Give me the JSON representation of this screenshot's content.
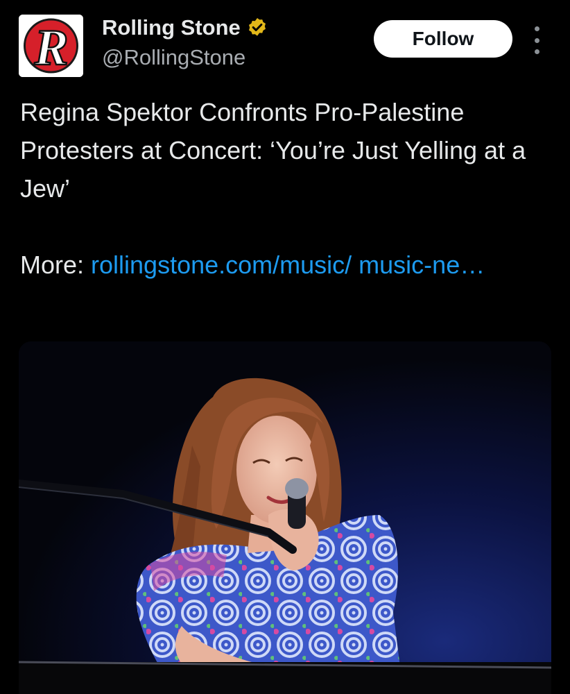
{
  "author": {
    "name": "Rolling Stone",
    "handle": "@RollingStone",
    "avatar_letter": "R",
    "verified_icon": "gold-verified-badge",
    "avatar_color": "#d6202a"
  },
  "actions": {
    "follow_label": "Follow",
    "more_icon": "vertical-ellipsis"
  },
  "tweet": {
    "headline": "Regina Spektor Confronts Pro-Palestine Protesters at Concert: ‘You’re Just Yelling at a Jew’",
    "more_label": "More: ",
    "link_text": "rollingstone.com/music/ music-ne…"
  },
  "media": {
    "type": "photo"
  },
  "colors": {
    "background": "#000000",
    "text": "#e7e9ea",
    "secondary_text": "#a9adb2",
    "link": "#1d9bf0",
    "verified_gold": "#e2b719"
  }
}
